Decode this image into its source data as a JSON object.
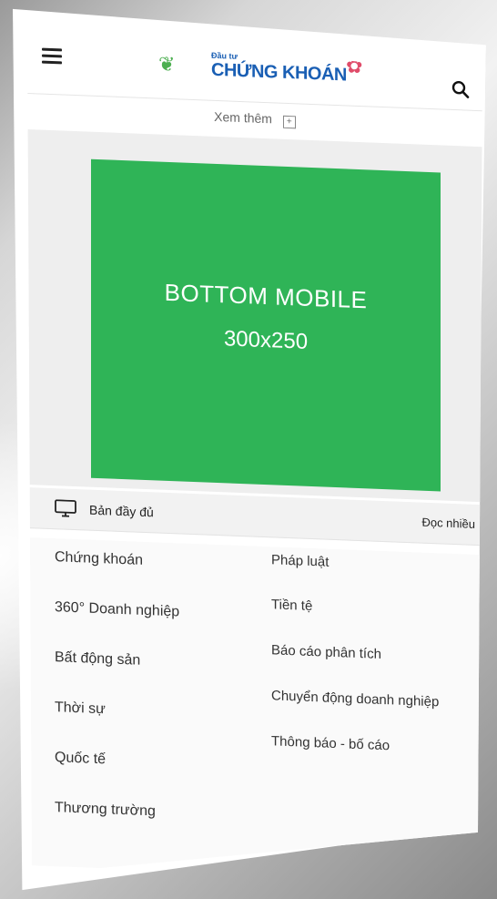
{
  "header": {
    "logo_small": "Đầu tư",
    "logo_big": "CHỨNG KHOÁN",
    "more_label": "Xem thêm"
  },
  "ad": {
    "line1": "BOTTOM MOBILE",
    "line2": "300x250",
    "color": "#2fb457"
  },
  "bar": {
    "full_version": "Bản đầy đủ",
    "most_read": "Đọc nhiều"
  },
  "menu": {
    "left": [
      {
        "label": "Chứng khoán"
      },
      {
        "label": "360° Doanh nghiệp"
      },
      {
        "label": "Bất động sản"
      },
      {
        "label": "Thời sự"
      },
      {
        "label": "Quốc tế"
      },
      {
        "label": "Thương trường"
      }
    ],
    "right": [
      {
        "label": "Pháp luật"
      },
      {
        "label": "Tiền tệ"
      },
      {
        "label": "Báo cáo phân tích"
      },
      {
        "label": "Chuyển động doanh nghiệp"
      },
      {
        "label": "Thông báo - bố cáo"
      }
    ]
  },
  "icons": {
    "menu": "hamburger-icon",
    "search": "search-icon",
    "expand": "plus-box-icon",
    "desktop": "monitor-icon"
  }
}
